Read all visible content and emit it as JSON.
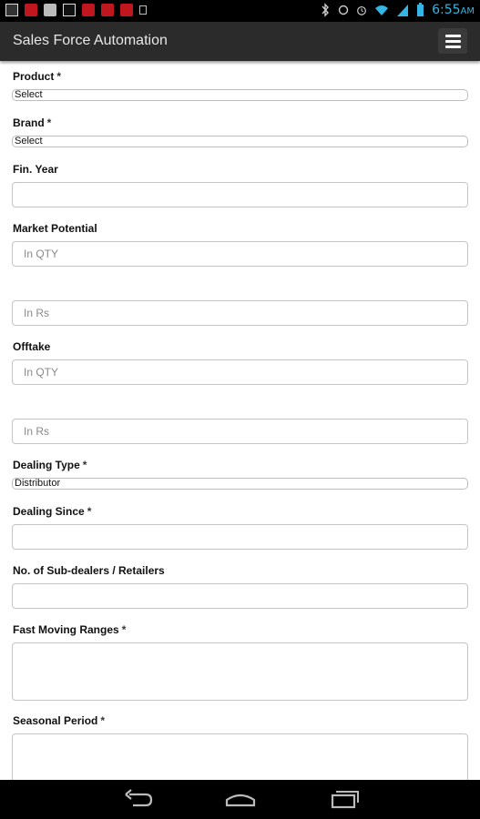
{
  "status_bar": {
    "time": "6:55",
    "time_suffix": "AM"
  },
  "app": {
    "title": "Sales Force Automation",
    "menu_icon": "hamburger-menu-icon"
  },
  "form": {
    "product": {
      "label": "Product",
      "required": "*",
      "value": "Select"
    },
    "brand": {
      "label": "Brand",
      "required": "*",
      "value": "Select"
    },
    "fin_year": {
      "label": "Fin. Year",
      "value": ""
    },
    "market_potential": {
      "label": "Market Potential",
      "qty_placeholder": "In QTY",
      "rs_placeholder": "In Rs"
    },
    "offtake": {
      "label": "Offtake",
      "qty_placeholder": "In QTY",
      "rs_placeholder": "In Rs"
    },
    "dealing_type": {
      "label": "Dealing Type",
      "required": "*",
      "value": "Distributor"
    },
    "dealing_since": {
      "label": "Dealing Since",
      "required": "*",
      "value": ""
    },
    "sub_dealers": {
      "label": "No. of Sub-dealers / Retailers",
      "value": ""
    },
    "fast_moving": {
      "label": "Fast Moving Ranges",
      "required": "*",
      "value": ""
    },
    "seasonal": {
      "label": "Seasonal Period",
      "required": "*",
      "value": ""
    }
  },
  "nav_bar": {
    "back_icon": "back-icon",
    "home_icon": "home-icon",
    "recents_icon": "recent-apps-icon"
  }
}
